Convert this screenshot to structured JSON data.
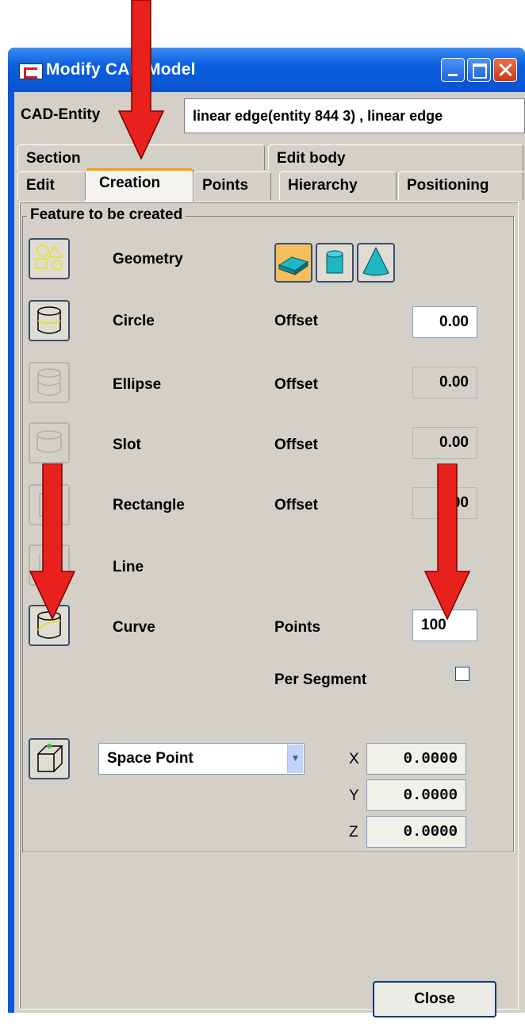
{
  "window": {
    "title": "Modify CAD Model"
  },
  "entity": {
    "label": "CAD-Entity",
    "value": "linear edge(entity 844 3) , linear edge"
  },
  "tabs": {
    "row1": [
      "Section",
      "Edit body"
    ],
    "row2": [
      "Edit",
      "Creation",
      "Points",
      "Hierarchy",
      "Positioning"
    ],
    "active": "Creation"
  },
  "group": {
    "title": "Feature to be created"
  },
  "features": {
    "geometry": {
      "label": "Geometry"
    },
    "circle": {
      "label": "Circle",
      "param_label": "Offset",
      "value": "0.00"
    },
    "ellipse": {
      "label": "Ellipse",
      "param_label": "Offset",
      "value": "0.00"
    },
    "slot": {
      "label": "Slot",
      "param_label": "Offset",
      "value": "0.00"
    },
    "rectangle": {
      "label": "Rectangle",
      "param_label": "Offset",
      "value": "0.00"
    },
    "line": {
      "label": "Line"
    },
    "curve": {
      "label": "Curve",
      "param_label": "Points",
      "value": "100",
      "per_segment_label": "Per Segment",
      "per_segment_checked": false
    }
  },
  "space_point": {
    "selected": "Space Point",
    "x_label": "X",
    "x_value": "0.0000",
    "y_label": "Y",
    "y_value": "0.0000",
    "z_label": "Z",
    "z_value": "0.0000"
  },
  "buttons": {
    "close": "Close"
  },
  "colors": {
    "titlebar": "#0a58d8",
    "dialog": "#d4d0c8",
    "active_tab": "#f5a000",
    "annotation_arrow": "#e8211c"
  }
}
